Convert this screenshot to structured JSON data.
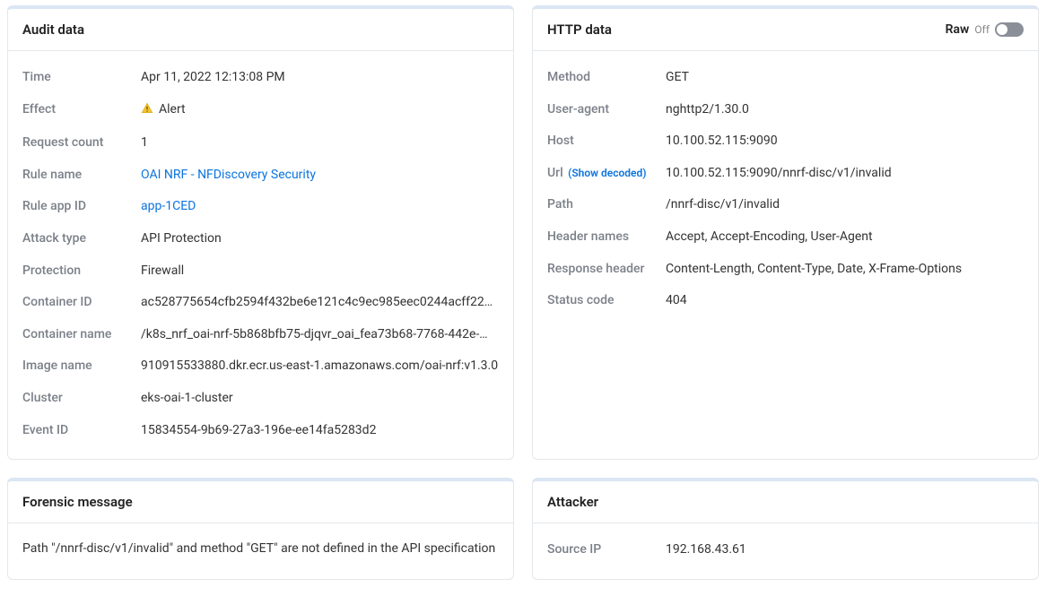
{
  "audit": {
    "title": "Audit data",
    "rows": {
      "time_label": "Time",
      "time_value": "Apr 11, 2022 12:13:08 PM",
      "effect_label": "Effect",
      "effect_value": "Alert",
      "request_count_label": "Request count",
      "request_count_value": "1",
      "rule_name_label": "Rule name",
      "rule_name_value": "OAI NRF - NFDiscovery Security",
      "rule_app_id_label": "Rule app ID",
      "rule_app_id_value": "app-1CED",
      "attack_type_label": "Attack type",
      "attack_type_value": "API Protection",
      "protection_label": "Protection",
      "protection_value": "Firewall",
      "container_id_label": "Container ID",
      "container_id_value": "ac528775654cfb2594f432be6e121c4c9ec985eec0244acff222…",
      "container_name_label": "Container name",
      "container_name_value": "/k8s_nrf_oai-nrf-5b868bfb75-djqvr_oai_fea73b68-7768-442e-…",
      "image_name_label": "Image name",
      "image_name_value": "910915533880.dkr.ecr.us-east-1.amazonaws.com/oai-nrf:v1.3.0",
      "cluster_label": "Cluster",
      "cluster_value": "eks-oai-1-cluster",
      "event_id_label": "Event ID",
      "event_id_value": "15834554-9b69-27a3-196e-ee14fa5283d2"
    }
  },
  "http": {
    "title": "HTTP data",
    "raw_label": "Raw",
    "off_label": "Off",
    "rows": {
      "method_label": "Method",
      "method_value": "GET",
      "user_agent_label": "User-agent",
      "user_agent_value": "nghttp2/1.30.0",
      "host_label": "Host",
      "host_value": "10.100.52.115:9090",
      "url_label": "Url",
      "url_aux": "(Show decoded)",
      "url_value": "10.100.52.115:9090/nnrf-disc/v1/invalid",
      "path_label": "Path",
      "path_value": "/nnrf-disc/v1/invalid",
      "header_names_label": "Header names",
      "header_names_value": "Accept, Accept-Encoding, User-Agent",
      "response_header_label": "Response header",
      "response_header_value": "Content-Length, Content-Type, Date, X-Frame-Options",
      "status_code_label": "Status code",
      "status_code_value": "404"
    }
  },
  "forensic": {
    "title": "Forensic message",
    "message": "Path \"/nnrf-disc/v1/invalid\" and method \"GET\" are not defined in the API specification"
  },
  "attacker": {
    "title": "Attacker",
    "source_ip_label": "Source IP",
    "source_ip_value": "192.168.43.61"
  }
}
